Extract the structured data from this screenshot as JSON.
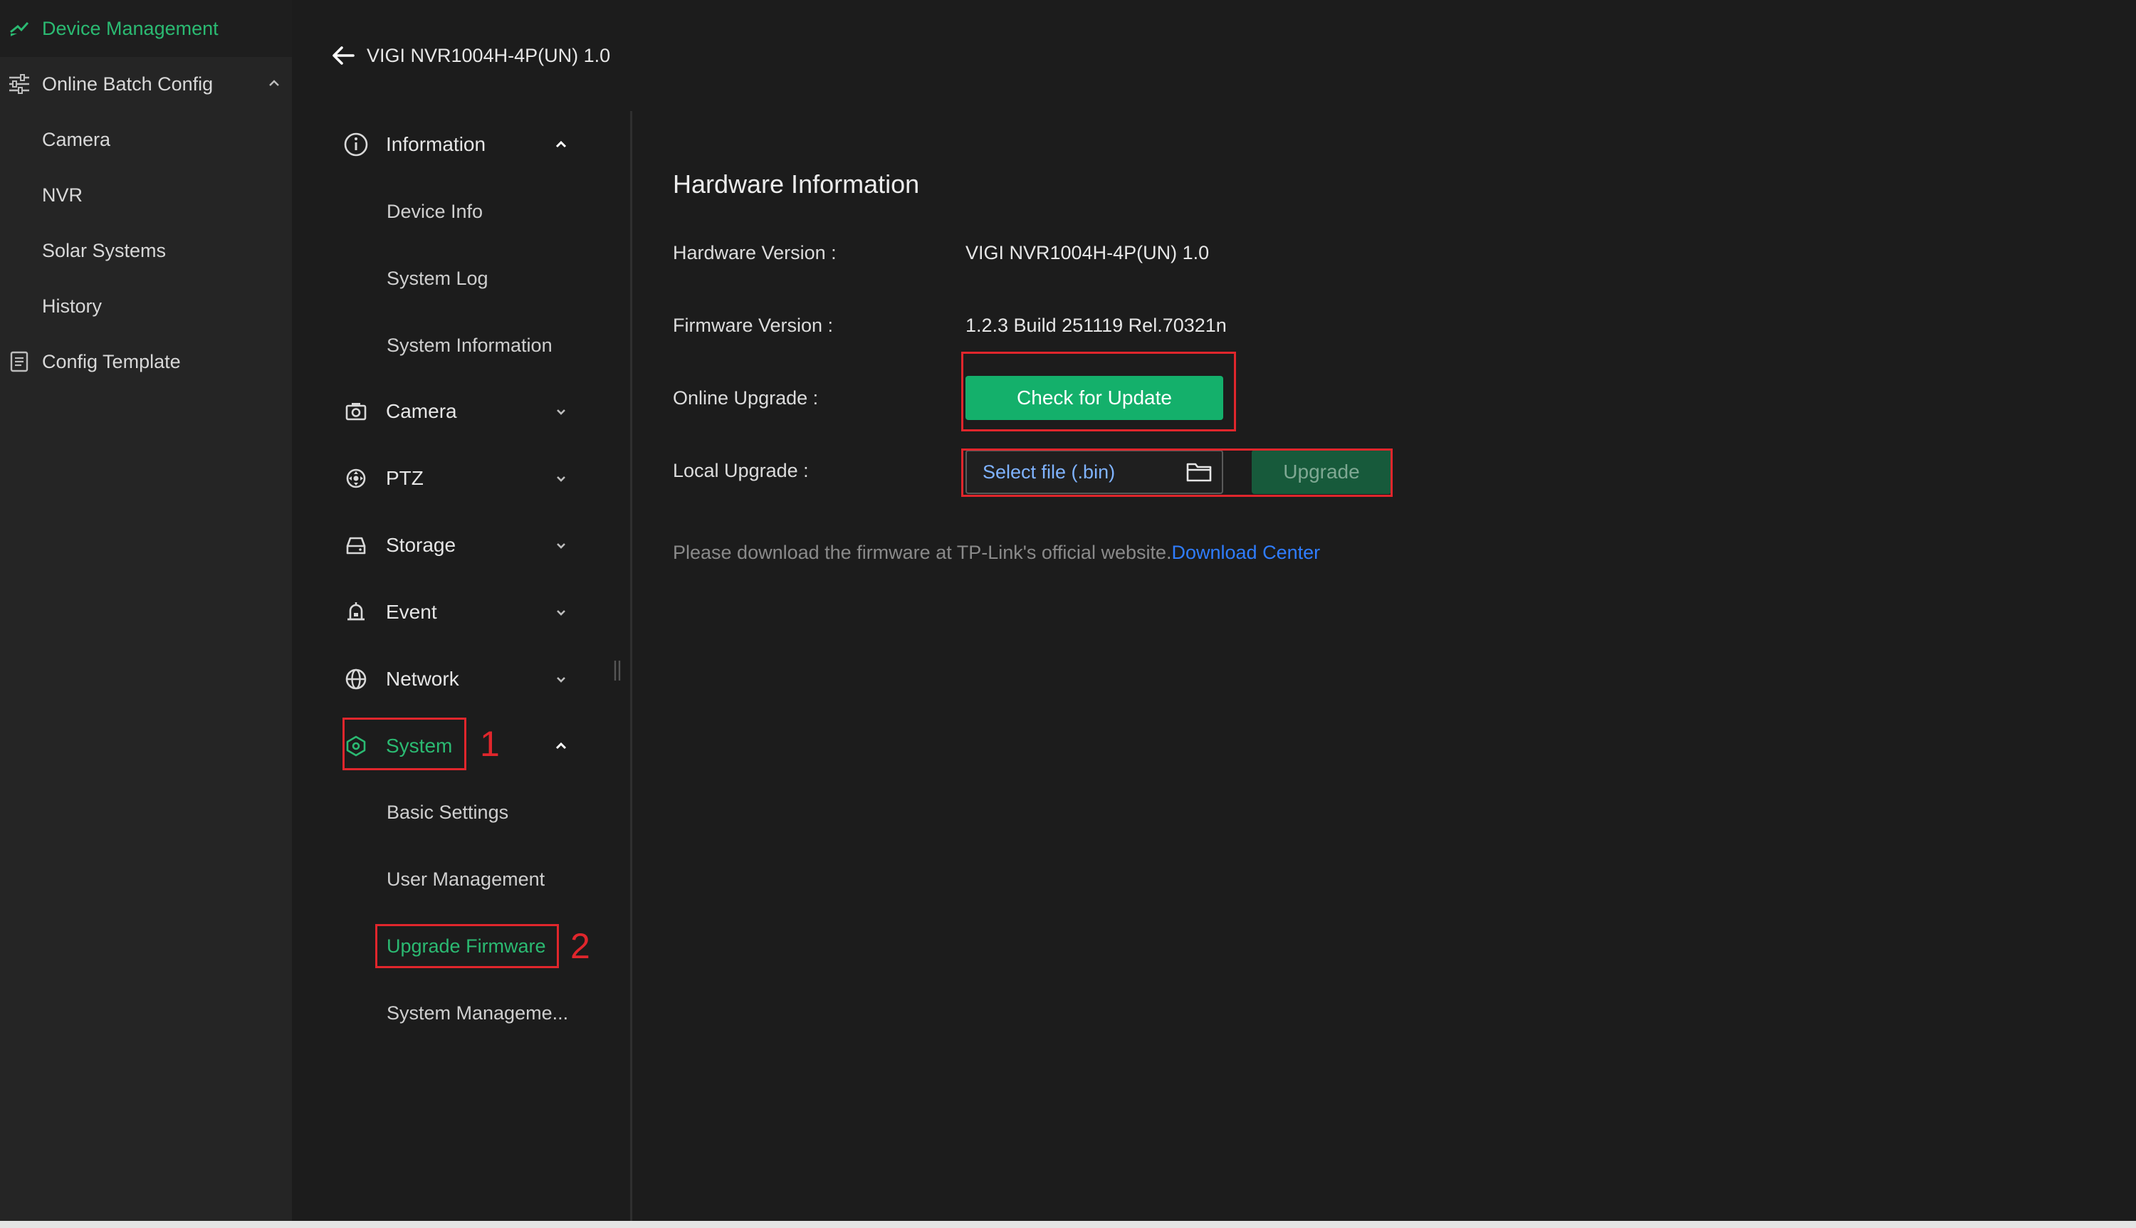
{
  "sidebar": {
    "header": "Device Management",
    "items": [
      {
        "label": "Online Batch Config",
        "icon": "sliders-icon"
      },
      {
        "label": "Camera"
      },
      {
        "label": "NVR"
      },
      {
        "label": "Solar Systems"
      },
      {
        "label": "History"
      },
      {
        "label": "Config Template",
        "icon": "document-icon"
      }
    ]
  },
  "header": {
    "title": "VIGI NVR1004H-4P(UN) 1.0"
  },
  "nav": {
    "information": {
      "label": "Information",
      "children": [
        "Device Info",
        "System Log",
        "System Information"
      ]
    },
    "camera": {
      "label": "Camera"
    },
    "ptz": {
      "label": "PTZ"
    },
    "storage": {
      "label": "Storage"
    },
    "event": {
      "label": "Event"
    },
    "network": {
      "label": "Network"
    },
    "system": {
      "label": "System",
      "children": [
        "Basic Settings",
        "User Management",
        "Upgrade Firmware",
        "System Manageme..."
      ]
    }
  },
  "annotations": {
    "step1": "1",
    "step2": "2"
  },
  "content": {
    "title": "Hardware Information",
    "hardware_label": "Hardware Version :",
    "hardware_value": "VIGI NVR1004H-4P(UN) 1.0",
    "firmware_label": "Firmware Version :",
    "firmware_value": "1.2.3 Build 251119 Rel.70321n",
    "online_label": "Online Upgrade :",
    "check_button": "Check for Update",
    "local_label": "Local Upgrade :",
    "file_placeholder": "Select file (.bin)",
    "upgrade_button": "Upgrade",
    "note_text": "Please download the firmware at TP-Link's official website.",
    "note_link": "Download Center"
  },
  "colors": {
    "accent": "#2bba72",
    "button_green": "#14b06b",
    "button_disabled": "#175a3b",
    "link": "#2f7dff",
    "highlight_red": "#e0262c"
  }
}
